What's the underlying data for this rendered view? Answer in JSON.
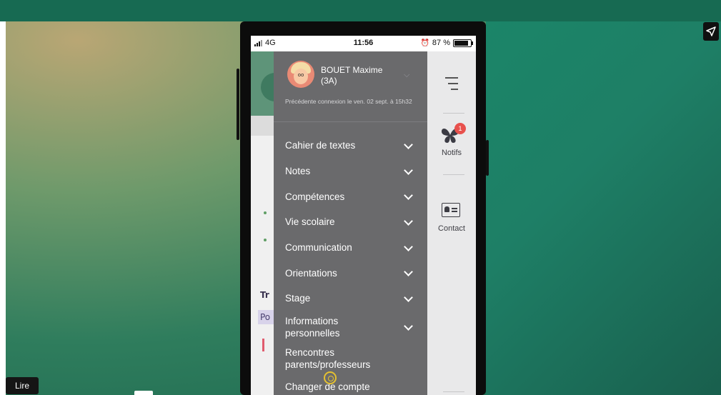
{
  "status_bar": {
    "network": "4G",
    "time": "11:56",
    "battery": "87 %",
    "battery_level": 0.87
  },
  "profile": {
    "name": "BOUET Maxime",
    "class": "(3A)",
    "last_login": "Précédente connexion le ven. 02 sept. à 15h32"
  },
  "menu": [
    {
      "label": "Cahier de textes"
    },
    {
      "label": "Notes"
    },
    {
      "label": "Compétences"
    },
    {
      "label": "Vie scolaire"
    },
    {
      "label": "Communication"
    },
    {
      "label": "Orientations"
    },
    {
      "label": "Stage"
    },
    {
      "label": "Informations personnelles"
    },
    {
      "label": "Rencontres parents/professeurs"
    },
    {
      "label": "Changer de compte"
    }
  ],
  "rail": {
    "notifs_label": "Notifs",
    "notifs_count": "1",
    "contact_label": "Contact"
  },
  "background_page": {
    "partial_heading": "Tr",
    "partial_tab": "Po"
  },
  "player": {
    "read_button": "Lire"
  },
  "colors": {
    "drawer_bg": "#6a6a6c",
    "badge": "#e8514d",
    "frame_teal": "#176a52"
  },
  "icons": [
    "share-icon",
    "signal-bars-icon",
    "alarm-icon",
    "battery-icon",
    "chevron-down-icon",
    "hamburger-icon",
    "butterfly-icon",
    "contact-card-icon"
  ]
}
